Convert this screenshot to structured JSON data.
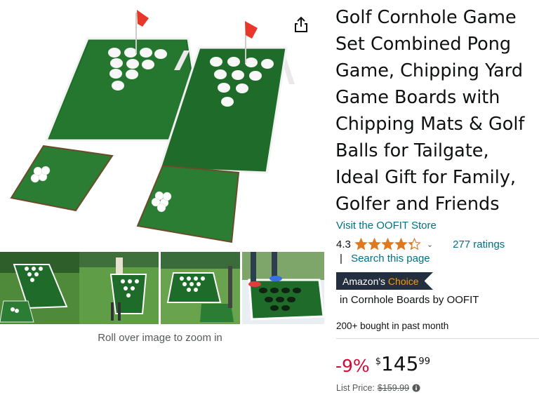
{
  "product": {
    "title": "Golf Cornhole Game Set Combined Pong Game, Chipping Yard Game Boards with Chipping Mats & Golf Balls for Tailgate, Ideal Gift for Family, Golfer and Friends",
    "store_link": "Visit the OOFIT Store",
    "rating_value": "4.3",
    "rating_stars": 4.3,
    "ratings_count": "277 ratings",
    "search_separator": "|",
    "search_link": "Search this page",
    "badge": {
      "prefix": "Amazon's",
      "accent": "Choice"
    },
    "badge_category": "in Cornhole Boards by OOFIT",
    "bought": "200+ bought in past month",
    "price": {
      "discount": "-9%",
      "currency": "$",
      "whole": "145",
      "fraction": "99",
      "list_label": "List Price:",
      "list_value": "$159.99"
    }
  },
  "gallery": {
    "zoom_hint": "Roll over image to zoom in",
    "thumbnails": [
      "thumbnail-boards-grass",
      "thumbnail-players-chipping",
      "thumbnail-boards-lawn",
      "thumbnail-player-stepping"
    ]
  },
  "colors": {
    "link": "#007185",
    "discount": "#cc0c39",
    "star": "#de7921",
    "badge_bg": "#232f3e",
    "badge_accent": "#ff9900"
  }
}
